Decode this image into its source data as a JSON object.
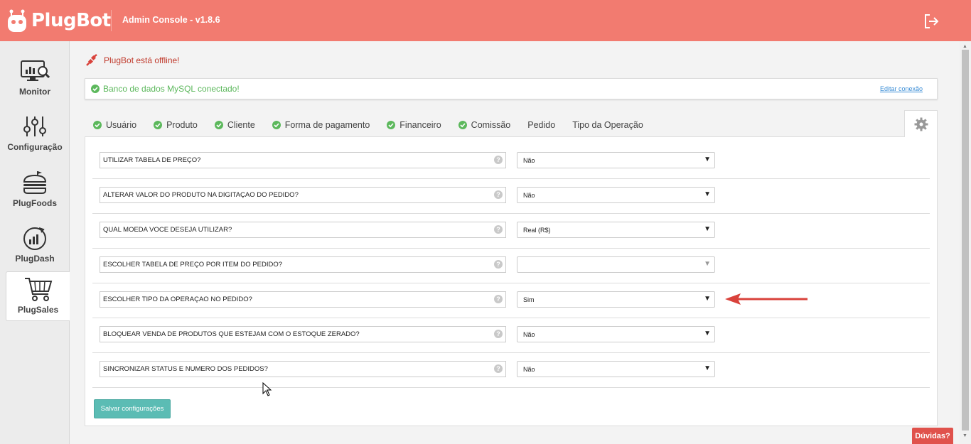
{
  "header": {
    "logo_text": "PlugBot",
    "app_title": "Admin Console - v1.8.6",
    "logout_icon": "logout-icon",
    "bg_color": "#f27b70"
  },
  "sidebar": {
    "items": [
      {
        "label": "Monitor",
        "icon": "monitor-chart-icon"
      },
      {
        "label": "Configuração",
        "icon": "sliders-icon"
      },
      {
        "label": "PlugFoods",
        "icon": "burger-icon"
      },
      {
        "label": "PlugDash",
        "icon": "dashboard-gauge-icon"
      },
      {
        "label": "PlugSales",
        "icon": "shopping-cart-icon",
        "active": true
      }
    ]
  },
  "status": {
    "offline_text": "PlugBot está offline!",
    "db_text": "Banco de dados MySQL conectado!",
    "edit_link": "Editar conexão"
  },
  "tabs": [
    {
      "label": "Usuário",
      "checked": true
    },
    {
      "label": "Produto",
      "checked": true
    },
    {
      "label": "Cliente",
      "checked": true
    },
    {
      "label": "Forma de pagamento",
      "checked": true
    },
    {
      "label": "Financeiro",
      "checked": true
    },
    {
      "label": "Comissão",
      "checked": true
    },
    {
      "label": "Pedido",
      "checked": false
    },
    {
      "label": "Tipo da Operação",
      "checked": false
    }
  ],
  "settings": [
    {
      "question": "UTILIZAR TABELA DE PREÇO?",
      "value": "Não"
    },
    {
      "question": "ALTERAR VALOR DO PRODUTO NA DIGITAÇAO DO PEDIDO?",
      "value": "Não"
    },
    {
      "question": "QUAL MOEDA VOCE DESEJA UTILIZAR?",
      "value": "Real (R$)"
    },
    {
      "question": "ESCOLHER TABELA DE PREÇO POR ITEM DO PEDIDO?",
      "value": ""
    },
    {
      "question": "ESCOLHER TIPO DA OPERAÇAO NO PEDIDO?",
      "value": "Sim"
    },
    {
      "question": "BLOQUEAR VENDA DE PRODUTOS QUE ESTEJAM COM O ESTOQUE ZERADO?",
      "value": "Não"
    },
    {
      "question": "SINCRONIZAR STATUS E NUMERO DOS PEDIDOS?",
      "value": "Não"
    }
  ],
  "help_glyph": "?",
  "save_button": "Salvar configurações",
  "help_button": "Dúvidas?",
  "colors": {
    "accent": "#f27b70",
    "success": "#5cb85c",
    "save": "#5bbcb4",
    "help": "#e0524c",
    "arrow": "#d9423b"
  }
}
